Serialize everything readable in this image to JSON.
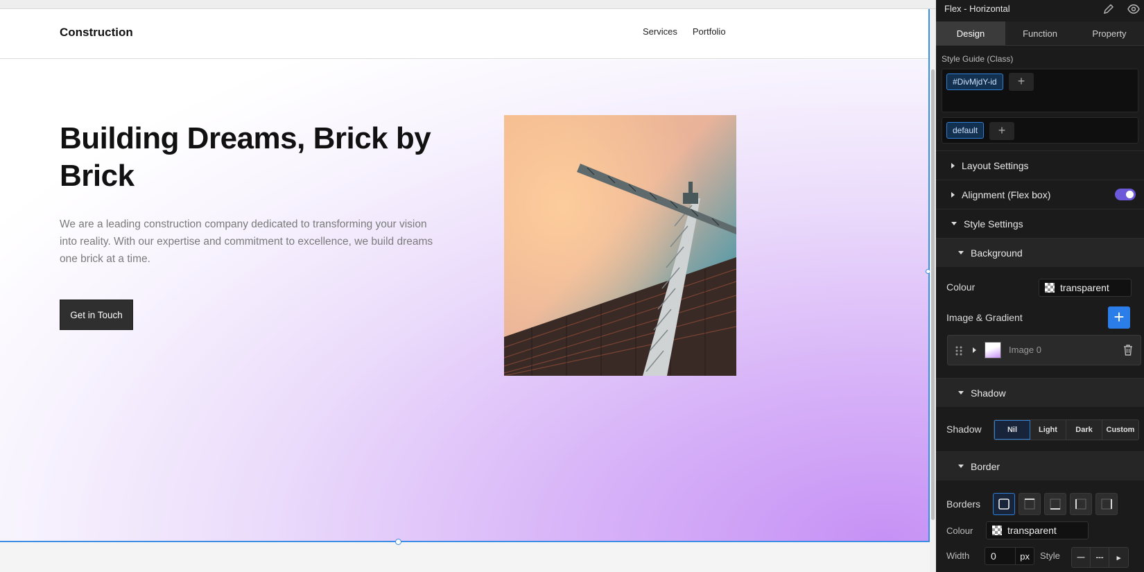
{
  "site": {
    "brand": "Construction",
    "nav": [
      "Services",
      "Portfolio"
    ],
    "hero_title": "Building Dreams, Brick by Brick",
    "hero_text": "We are a leading construction company dedicated to transforming your vision into reality. With our expertise and commitment to excellence, we build dreams one brick at a time.",
    "cta_label": "Get in Touch"
  },
  "panel": {
    "title": "Flex - Horizontal",
    "tabs": [
      "Design",
      "Function",
      "Property"
    ],
    "active_tab": "Design",
    "style_guide_label": "Style Guide (Class)",
    "class_chip": "#DivMjdY-id",
    "state_chip": "default",
    "sections": {
      "layout": "Layout Settings",
      "alignment": "Alignment (Flex box)",
      "style": "Style Settings",
      "background": "Background",
      "shadow": "Shadow",
      "border": "Border"
    },
    "background": {
      "colour_label": "Colour",
      "colour_value": "transparent",
      "image_gradient_label": "Image & Gradient",
      "image_item": "Image 0"
    },
    "shadow": {
      "label": "Shadow",
      "options": [
        "Nil",
        "Light",
        "Dark",
        "Custom"
      ],
      "selected": "Nil"
    },
    "border": {
      "borders_label": "Borders",
      "colour_label": "Colour",
      "colour_value": "transparent",
      "width_label": "Width",
      "width_value": "0",
      "width_unit": "px",
      "style_label": "Style"
    }
  },
  "colors": {
    "accent": "#2b7de9",
    "toggle": "#6b59d9",
    "selection": "#3a8ee6",
    "hero_gradient_end": "#c691f5"
  }
}
